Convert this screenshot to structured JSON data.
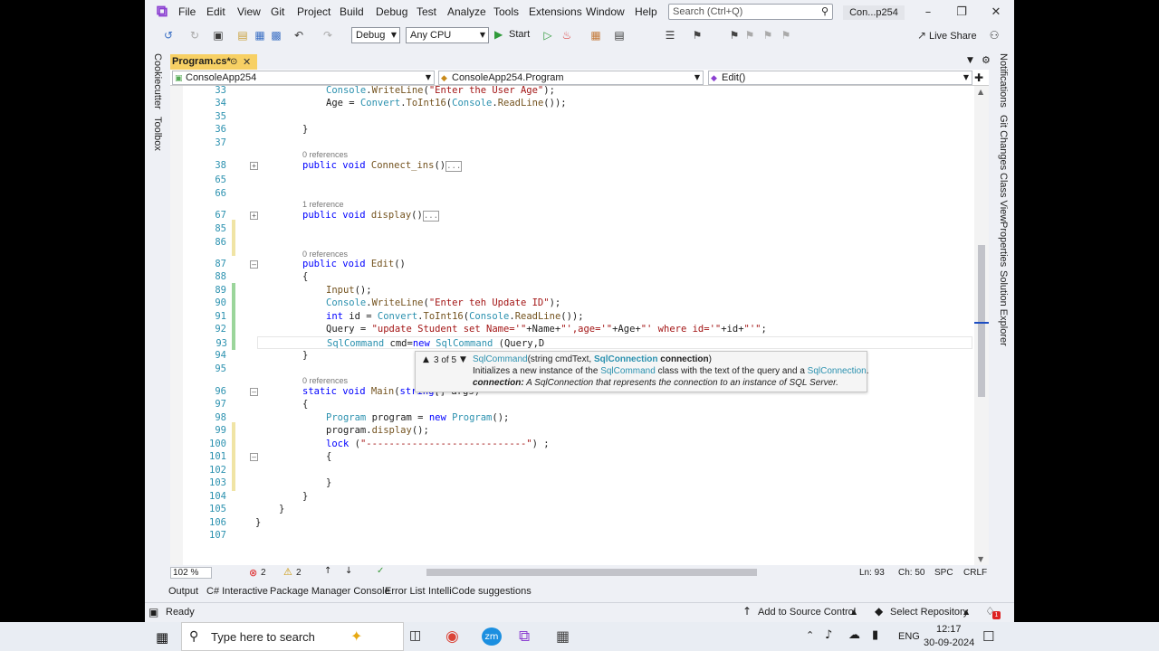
{
  "menu": [
    "File",
    "Edit",
    "View",
    "Git",
    "Project",
    "Build",
    "Debug",
    "Test",
    "Analyze",
    "Tools",
    "Extensions",
    "Window",
    "Help"
  ],
  "search_placeholder": "Search (Ctrl+Q)",
  "solution_title": "Con...p254",
  "toolbar": {
    "config": "Debug",
    "platform": "Any CPU",
    "start": "Start",
    "live_share": "Live Share"
  },
  "tab": {
    "name": "Program.cs*"
  },
  "left_tools": [
    "Cookiecutter",
    "Toolbox"
  ],
  "right_tools": [
    "Notifications",
    "Git Changes",
    "Class View",
    "Properties",
    "Solution Explorer"
  ],
  "nav": {
    "project": "ConsoleApp254",
    "class": "ConsoleApp254.Program",
    "member": "Edit()"
  },
  "refs": {
    "r0": "0 references",
    "r1": "1 reference"
  },
  "collapsed": "...",
  "lines": [
    {
      "n": "33",
      "c": "Console.WriteLine(\"Enter the User Age\");"
    },
    {
      "n": "34",
      "c": "Age = Convert.ToInt16(Console.ReadLine());"
    },
    {
      "n": "35",
      "c": ""
    },
    {
      "n": "36",
      "c": "}"
    },
    {
      "n": "37",
      "c": ""
    },
    {
      "n": "38",
      "c": "public void Connect_ins()"
    },
    {
      "n": "65",
      "c": ""
    },
    {
      "n": "66",
      "c": ""
    },
    {
      "n": "67",
      "c": "public void display()"
    },
    {
      "n": "85",
      "c": ""
    },
    {
      "n": "86",
      "c": ""
    },
    {
      "n": "87",
      "c": "public void Edit()"
    },
    {
      "n": "88",
      "c": "{"
    },
    {
      "n": "89",
      "c": "Input();"
    },
    {
      "n": "90",
      "c": "Console.WriteLine(\"Enter teh Update ID\");"
    },
    {
      "n": "91",
      "c": "int id = Convert.ToInt16(Console.ReadLine());"
    },
    {
      "n": "92",
      "c": "Query = \"update Student set Name='\"+Name+\"',age='\"+Age+\"' where id='\"+id+\"'\";"
    },
    {
      "n": "93",
      "c": "SqlCommand cmd=new SqlCommand (Query,D"
    },
    {
      "n": "94",
      "c": "}"
    },
    {
      "n": "95",
      "c": ""
    },
    {
      "n": "96",
      "c": "static void Main(string[] args)"
    },
    {
      "n": "97",
      "c": "{"
    },
    {
      "n": "98",
      "c": "Program program = new Program();"
    },
    {
      "n": "99",
      "c": "program.display();"
    },
    {
      "n": "100",
      "c": "lock (\"----------------------------\") ;"
    },
    {
      "n": "101",
      "c": "{"
    },
    {
      "n": "102",
      "c": ""
    },
    {
      "n": "103",
      "c": "}"
    },
    {
      "n": "104",
      "c": "}"
    },
    {
      "n": "105",
      "c": "}"
    },
    {
      "n": "106",
      "c": "}"
    },
    {
      "n": "107",
      "c": ""
    }
  ],
  "tooltip": {
    "counter": "3 of 5",
    "sig_type": "SqlCommand",
    "sig_p1": "(string cmdText, ",
    "sig_p2type": "SqlConnection",
    "sig_p2": " connection",
    "sig_close": ")",
    "desc1": "Initializes a new instance of the ",
    "desc_type": "SqlCommand",
    "desc2": " class with the text of the query and a ",
    "desc_type2": "SqlConnection",
    "desc3": ".",
    "param_name": "connection:",
    "param_desc": " A SqlConnection that represents the connection to an instance of SQL Server."
  },
  "editor_status": {
    "zoom": "102 %",
    "errors": "2",
    "warnings": "2",
    "ln": "Ln: 93",
    "ch": "Ch: 50",
    "spc": "SPC",
    "crlf": "CRLF"
  },
  "bottom_tabs": [
    "Output",
    "C# Interactive",
    "Package Manager Console",
    "Error List",
    "IntelliCode suggestions"
  ],
  "status": {
    "ready": "Ready",
    "source_control": "Add to Source Control",
    "repo": "Select Repository",
    "notif": "1"
  },
  "taskbar": {
    "search": "Type here to search",
    "lang": "ENG",
    "time": "12:17",
    "date": "30-09-2024"
  },
  "colors": {
    "accent": "#8b3fd1",
    "tab": "#f7d064",
    "keyword": "#0000ff",
    "type": "#2b91af",
    "string": "#a31515"
  }
}
